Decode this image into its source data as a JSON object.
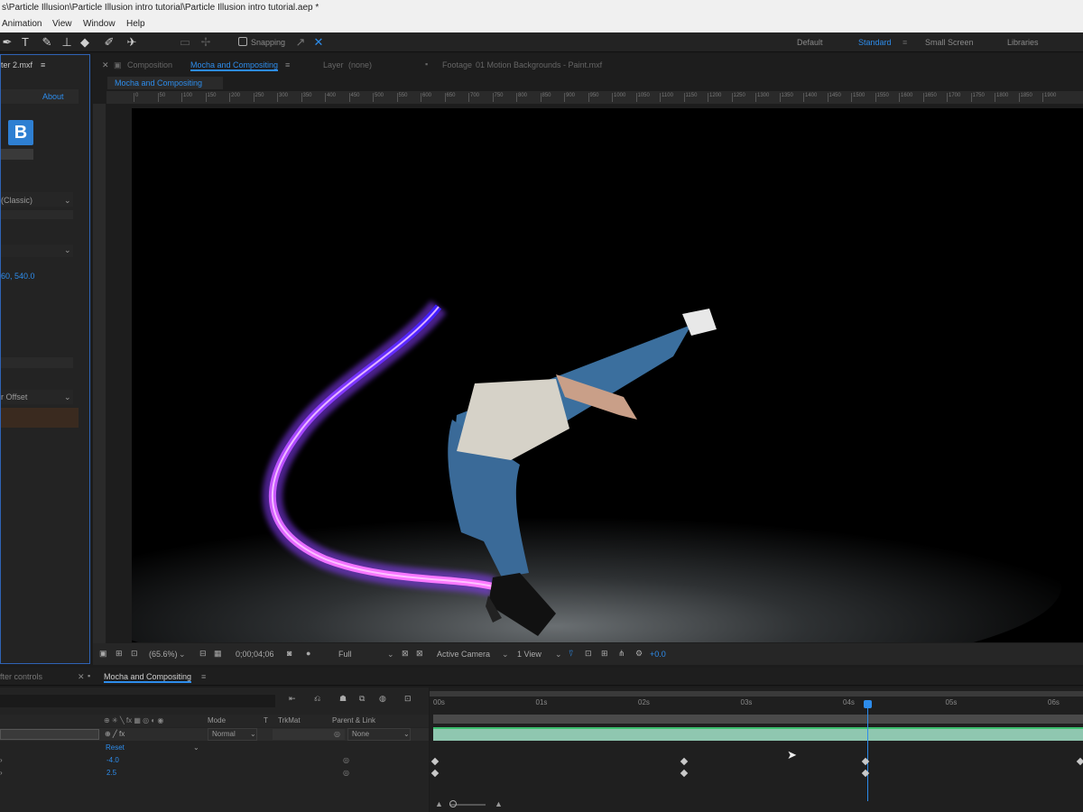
{
  "window": {
    "title": "s\\Particle Illusion\\Particle Illusion intro tutorial\\Particle Illusion intro tutorial.aep *"
  },
  "menu": {
    "items": [
      "Animation",
      "View",
      "Window",
      "Help"
    ]
  },
  "toolbar": {
    "snapping_label": "Snapping",
    "workspaces": [
      "Default",
      "Standard",
      "Small Screen",
      "Libraries"
    ],
    "active_workspace": "Standard"
  },
  "left_panel": {
    "tab_label": "ter 2.mxf",
    "about_label": "About",
    "plugin_logo_letter": "B",
    "dropdown1": "(Classic)",
    "coordinate_value": "60, 540.0",
    "dropdown3": "r Offset"
  },
  "viewer": {
    "tabs": [
      {
        "prefix": "Composition",
        "name": "Mocha and Compositing"
      },
      {
        "prefix": "Layer",
        "name": "(none)"
      },
      {
        "prefix": "Footage",
        "name": "01 Motion Backgrounds - Paint.mxf"
      }
    ],
    "breadcrumb": "Mocha and Compositing",
    "ruler_labels": [
      "0",
      "50",
      "100",
      "150",
      "200",
      "250",
      "300",
      "350",
      "400",
      "450",
      "500",
      "550",
      "600",
      "650",
      "700",
      "750",
      "800",
      "850",
      "900",
      "950",
      "1000",
      "1050",
      "1100",
      "1150",
      "1200",
      "1250",
      "1300",
      "1350",
      "1400",
      "1450",
      "1500",
      "1550",
      "1600",
      "1650",
      "1700",
      "1750",
      "1800",
      "1850",
      "1900"
    ],
    "zoom": "(65.6%)",
    "timecode": "0;00;04;06",
    "resolution": "Full",
    "camera": "Active Camera",
    "views": "1 View",
    "exposure": "+0.0"
  },
  "timeline": {
    "tabs": [
      "fter controls",
      "Mocha and Compositing"
    ],
    "column_headers": [
      "Mode",
      "T",
      "TrkMat",
      "Parent & Link"
    ],
    "layer": {
      "mode": "Normal",
      "parent": "None"
    },
    "reset_label": "Reset",
    "values": [
      "-4.0",
      "2.5"
    ],
    "time_markers": [
      "00s",
      "01s",
      "02s",
      "03s",
      "04s",
      "05s",
      "06s"
    ],
    "playhead_fraction": 0.67
  },
  "colors": {
    "accent_blue": "#2d8ceb",
    "work_bar": "#8fc7b0",
    "trail_purple": "#8a3cff"
  }
}
